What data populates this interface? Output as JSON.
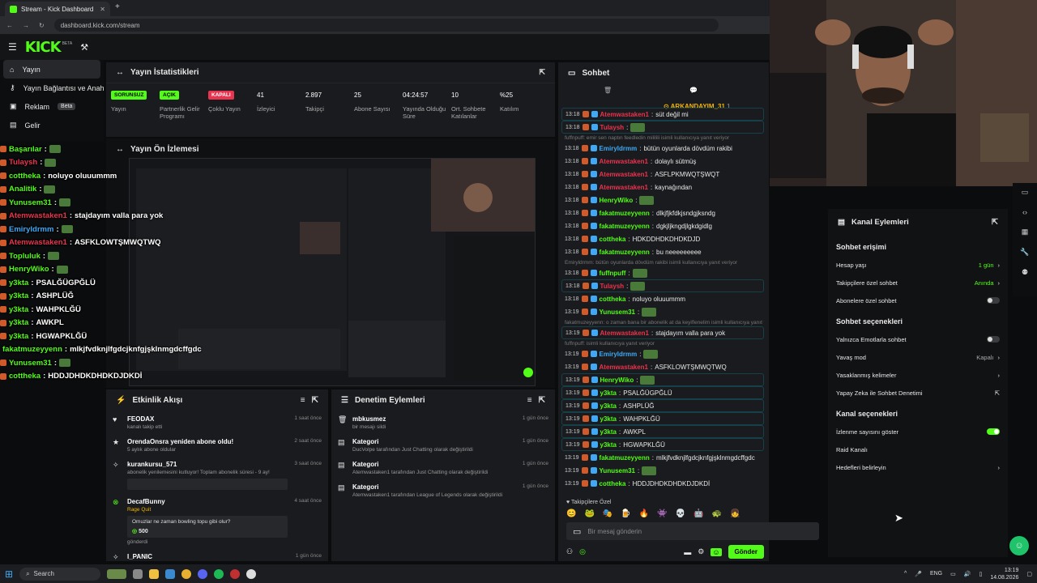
{
  "browser": {
    "tab_title": "Stream - Kick Dashboard",
    "url": "dashboard.kick.com/stream"
  },
  "kick": {
    "logo": "KICK",
    "beta": "BETA"
  },
  "sidebar": {
    "items": [
      {
        "label": "Yayın"
      },
      {
        "label": "Yayın Bağlantısı ve Anahtarı"
      },
      {
        "label": "Reklam",
        "badge": "Beta"
      },
      {
        "label": "Gelir"
      }
    ]
  },
  "stats": {
    "title": "Yayın İstatistikleri",
    "items": [
      {
        "value": "SORUNSUZ",
        "label": "Yayın",
        "pill": "#53fc18"
      },
      {
        "value": "AÇIK",
        "label": "Partnerlik Gelir Programı",
        "pill": "#53fc18"
      },
      {
        "value": "KAPALI",
        "label": "Çoklu Yayın",
        "pill": "#e8344e"
      },
      {
        "value": "41",
        "label": "İzleyici"
      },
      {
        "value": "2.897",
        "label": "Takipçi"
      },
      {
        "value": "25",
        "label": "Abone Sayısı"
      },
      {
        "value": "04:24:57",
        "label": "Yayında Olduğu Süre"
      },
      {
        "value": "10",
        "label": "Ort. Sohbete Katılanlar"
      },
      {
        "value": "%25",
        "label": "Katılım"
      }
    ]
  },
  "preview": {
    "title": "Yayın Ön İzlemesi"
  },
  "activity": {
    "title": "Etkinlik Akışı",
    "items": [
      {
        "title": "FEODAX",
        "sub": "kanalı takip etti",
        "time": "1 saat önce",
        "icon": "heart-icon"
      },
      {
        "title": "OrendaOnsra yeniden abone oldu!",
        "sub": "5 aylık abone oldular",
        "time": "2 saat önce",
        "icon": "star-icon"
      },
      {
        "title": "kurankursu_571",
        "sub": "abonelik yenilemesini kutluyor! Toplam abonelik süresi - 9 ay!",
        "time": "3 saat önce",
        "icon": "sparkle-icon"
      },
      {
        "title": "DecafBunny",
        "sub": "Rage Quit",
        "time": "4 saat önce",
        "icon": "kick-icon",
        "extra": "Omuzlar ne zaman bowling topu gibi olur?",
        "amount": "500",
        "extra2": "gönderdi"
      },
      {
        "title": "I_PANIC",
        "sub": "",
        "time": "1 gün önce",
        "icon": "sparkle-icon"
      }
    ]
  },
  "modlog": {
    "title": "Denetim Eylemleri",
    "items": [
      {
        "title": "mbkusmez",
        "sub": "bir mesajı sildi",
        "time": "1 gün önce"
      },
      {
        "title": "Kategori",
        "sub": "DucVolpe tarafından Just Chatting olarak değiştirildi",
        "time": "1 gün önce"
      },
      {
        "title": "Kategori",
        "sub": "Atemwastaken1 tarafından Just Chatting olarak değiştirildi",
        "time": "1 gün önce"
      },
      {
        "title": "Kategori",
        "sub": "Atemwastaken1 tarafından League of Legends olarak değiştirildi",
        "time": "1 gün önce"
      }
    ]
  },
  "chat": {
    "title": "Sohbet",
    "pinned": "ARKANDAYIM_31",
    "input_placeholder": "Bir mesaj gönderin",
    "send": "Gönder",
    "emote_label": "Takipçilere Özel",
    "messages": [
      {
        "t": "13:18",
        "u": "Atemwastaken1",
        "c": "#e8344e",
        "m": "süt değil mi",
        "hl": true
      },
      {
        "t": "13:18",
        "u": "Tulaysh",
        "c": "#e8344e",
        "m": "",
        "hl": true
      },
      {
        "reply": "fuffnpuff: emir sen naptın feedledin mililili isimli kullanıcıya yanıt veriyor"
      },
      {
        "t": "13:18",
        "u": "Emiryldrmm",
        "c": "#3fa9f5",
        "m": "bütün oyunlarda dövdüm rakibi"
      },
      {
        "t": "13:18",
        "u": "Atemwastaken1",
        "c": "#e8344e",
        "m": "dolaylı sütmüş"
      },
      {
        "t": "13:18",
        "u": "Atemwastaken1",
        "c": "#e8344e",
        "m": "ASFLPKMWQTŞWQT"
      },
      {
        "t": "13:18",
        "u": "Atemwastaken1",
        "c": "#e8344e",
        "m": "kaynağından"
      },
      {
        "t": "13:18",
        "u": "HenryWiko",
        "c": "#53fc18",
        "m": ""
      },
      {
        "t": "13:18",
        "u": "fakatmuzeyyenn",
        "c": "#53fc18",
        "m": "dlkjfjkfdkjsndgjksndg"
      },
      {
        "t": "13:18",
        "u": "fakatmuzeyyenn",
        "c": "#53fc18",
        "m": "dgkjljkngdjlgkdgidlg"
      },
      {
        "t": "13:18",
        "u": "cottheka",
        "c": "#53fc18",
        "m": "HDKDDHDKDHDKDJD"
      },
      {
        "t": "13:18",
        "u": "fakatmuzeyyenn",
        "c": "#53fc18",
        "m": "bu neeeeeeeee"
      },
      {
        "reply": "Emiryldrmm: bütün oyunlarda dövdüm rakibi isimli kullanıcıya yanıt veriyor"
      },
      {
        "t": "13:18",
        "u": "fuffnpuff",
        "c": "#53fc18",
        "m": ""
      },
      {
        "t": "13:18",
        "u": "Tulaysh",
        "c": "#e8344e",
        "m": "",
        "hl": true
      },
      {
        "t": "13:18",
        "u": "cottheka",
        "c": "#53fc18",
        "m": "noluyo oluuummm"
      },
      {
        "t": "13:19",
        "u": "Yunusem31",
        "c": "#53fc18",
        "m": ""
      },
      {
        "reply": "fakatmuzeyyenn: o zaman bana bir abonelik at da keyiflenelim isimli kullanıcıya yanıt veriyor"
      },
      {
        "t": "13:19",
        "u": "Atemwastaken1",
        "c": "#e8344e",
        "m": "stajdayım valla para yok",
        "hl": true
      },
      {
        "reply": "fuffnpuff: isimli kullanıcıya yanıt veriyor"
      },
      {
        "t": "13:19",
        "u": "Emiryldrmm",
        "c": "#3fa9f5",
        "m": ""
      },
      {
        "t": "13:19",
        "u": "Atemwastaken1",
        "c": "#e8344e",
        "m": "ASFKLOWTŞMWQTWQ"
      },
      {
        "t": "13:19",
        "u": "HenryWiko",
        "c": "#53fc18",
        "m": "",
        "hl": true
      },
      {
        "t": "13:19",
        "u": "y3kta",
        "c": "#53fc18",
        "m": "PSALĞÜGPĞLÜ",
        "hl": true
      },
      {
        "t": "13:19",
        "u": "y3kta",
        "c": "#53fc18",
        "m": "ASHPLÜĞ",
        "hl": true
      },
      {
        "t": "13:19",
        "u": "y3kta",
        "c": "#53fc18",
        "m": "WAHPKLĞÜ",
        "hl": true
      },
      {
        "t": "13:19",
        "u": "y3kta",
        "c": "#53fc18",
        "m": "AWKPL",
        "hl": true
      },
      {
        "t": "13:19",
        "u": "y3kta",
        "c": "#53fc18",
        "m": "HGWAPKLĞÜ",
        "hl": true
      },
      {
        "t": "13:19",
        "u": "fakatmuzeyyenn",
        "c": "#53fc18",
        "m": "mlkjfvdknjlfgdcjknfgjşklnmgdcffgdc"
      },
      {
        "t": "13:19",
        "u": "Yunusem31",
        "c": "#53fc18",
        "m": ""
      },
      {
        "t": "13:19",
        "u": "cottheka",
        "c": "#53fc18",
        "m": "HDDJDHDKDHDKDJDKDİ"
      }
    ]
  },
  "channel_actions": {
    "title": "Kanal Eylemleri",
    "sections": [
      {
        "title": "Sohbet erişimi",
        "rows": [
          {
            "label": "Hesap yaşı",
            "value": "1 gün",
            "arrow": true
          },
          {
            "label": "Takipçilere özel sohbet",
            "value": "Anında",
            "arrow": true
          },
          {
            "label": "Abonelere özel sohbet",
            "toggle": false
          }
        ]
      },
      {
        "title": "Sohbet seçenekleri",
        "rows": [
          {
            "label": "Yalnızca Emotlarla sohbet",
            "toggle": false
          },
          {
            "label": "Yavaş mod",
            "value": "Kapalı",
            "arrow": true
          },
          {
            "label": "Yasaklanmış kelimeler",
            "arrow": true
          },
          {
            "label": "Yapay Zeka ile Sohbet Denetimi",
            "ext": true
          }
        ]
      },
      {
        "title": "Kanal seçenekleri",
        "rows": [
          {
            "label": "İzlenme sayısını göster",
            "toggle": true
          },
          {
            "label": "Raid Kanalı"
          },
          {
            "label": "Hedefleri belirleyin",
            "arrow": true
          }
        ]
      }
    ]
  },
  "overlay": {
    "lines": [
      {
        "u": "Başarılar",
        "m": ""
      },
      {
        "u": "Tulaysh",
        "m": ""
      },
      {
        "u": "cottheka",
        "m": "noluyo oluuummm"
      },
      {
        "u": "Analitik",
        "m": ""
      },
      {
        "u": "Yunusem31",
        "m": ""
      },
      {
        "u": "Atemwastaken1",
        "m": "stajdayım valla para yok"
      },
      {
        "u": "Emiryldrmm",
        "m": ""
      },
      {
        "u": "Atemwastaken1",
        "m": "ASFKLOWTŞMWQTWQ"
      },
      {
        "u": "Topluluk",
        "m": ""
      },
      {
        "u": "HenryWiko",
        "m": ""
      },
      {
        "u": "y3kta",
        "m": "PSALĞÜGPĞLÜ"
      },
      {
        "u": "y3kta",
        "m": "ASHPLÜĞ"
      },
      {
        "u": "y3kta",
        "m": "WAHPKLĞÜ"
      },
      {
        "u": "y3kta",
        "m": "AWKPL"
      },
      {
        "u": "y3kta",
        "m": "HGWAPKLĞÜ"
      },
      {
        "u": "fakatmuzeyyenn",
        "m": "mlkjfvdknjlfgdcjknfgjşklnmgdcffgdc"
      },
      {
        "u": "Yunusem31",
        "m": ""
      },
      {
        "u": "cottheka",
        "m": "HDDJDHDKDHDKDJDKDİ"
      }
    ]
  },
  "taskbar": {
    "search": "Search",
    "lang": "ENG",
    "time": "13:19",
    "date": "14.08.2026"
  },
  "colors": {
    "accent": "#53fc18",
    "danger": "#e8344e",
    "blue": "#3fa9f5"
  }
}
